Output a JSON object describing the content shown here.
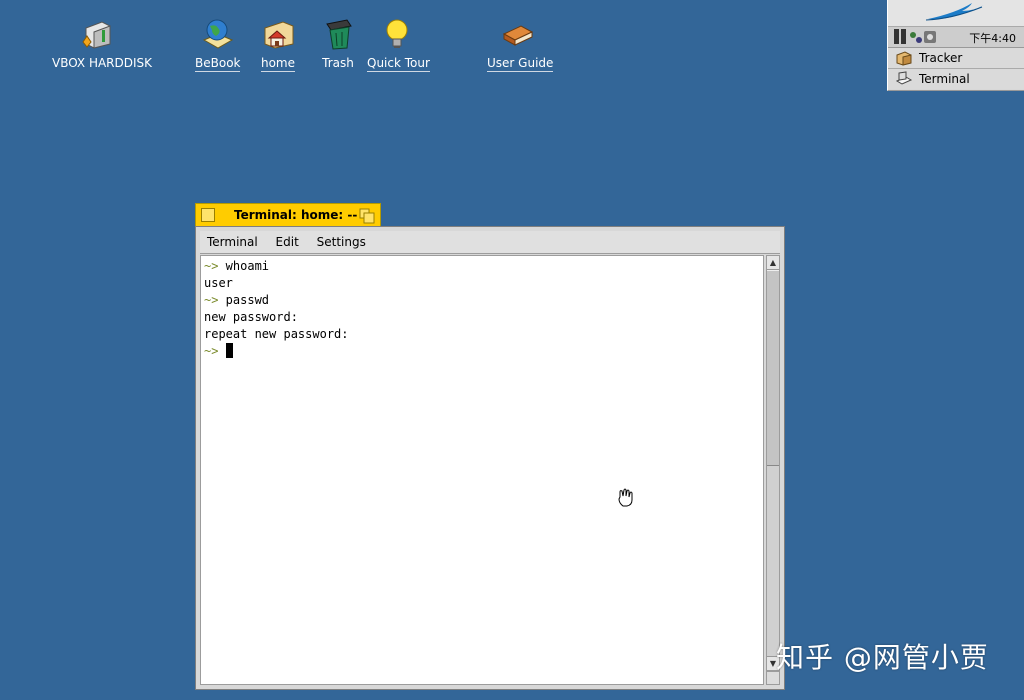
{
  "desktop": {
    "icons": [
      {
        "label": "VBOX HARDDISK",
        "icon": "harddisk-icon"
      },
      {
        "label": "BeBook",
        "icon": "globe-book-icon"
      },
      {
        "label": "home",
        "icon": "home-folder-icon"
      },
      {
        "label": "Trash",
        "icon": "trash-icon"
      },
      {
        "label": "Quick Tour",
        "icon": "lightbulb-icon"
      },
      {
        "label": "User Guide",
        "icon": "book-icon"
      }
    ],
    "background_color": "#336698"
  },
  "deskbar": {
    "clock": "下午4:40",
    "apps": [
      {
        "label": "Tracker",
        "icon": "tracker-icon"
      },
      {
        "label": "Terminal",
        "icon": "terminal-icon"
      }
    ]
  },
  "terminal": {
    "title": "Terminal: home: --",
    "accent_color": "#ffcc00",
    "menu": [
      "Terminal",
      "Edit",
      "Settings"
    ],
    "lines": [
      {
        "prompt": "~>",
        "text": " whoami"
      },
      {
        "prompt": "",
        "text": "user"
      },
      {
        "prompt": "~>",
        "text": " passwd"
      },
      {
        "prompt": "",
        "text": "new password:"
      },
      {
        "prompt": "",
        "text": "repeat new password:"
      },
      {
        "prompt": "~>",
        "text": " "
      }
    ]
  },
  "watermark": "知乎 @网管小贾"
}
